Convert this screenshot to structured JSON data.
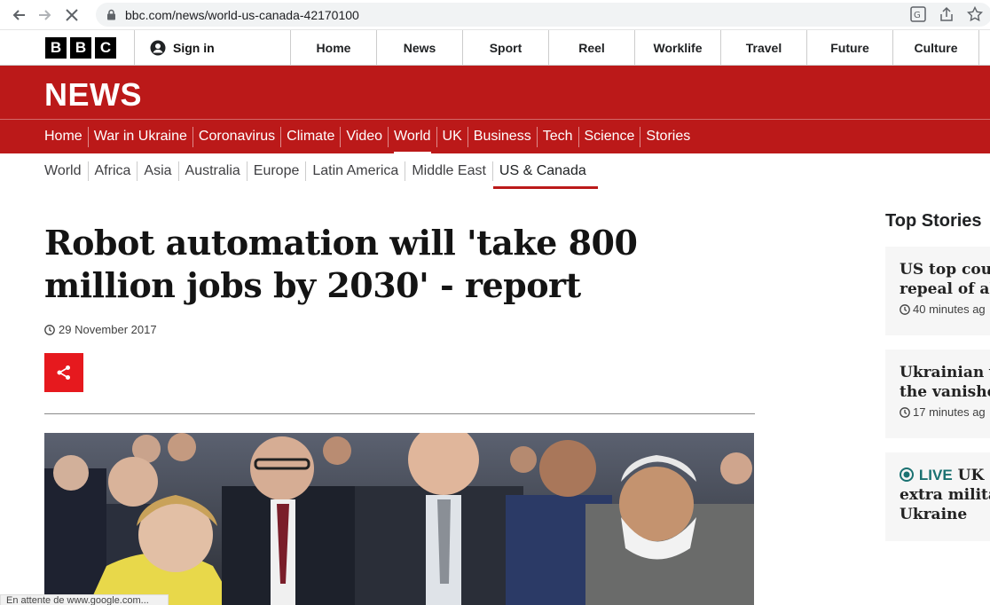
{
  "browser": {
    "url": "bbc.com/news/world-us-canada-42170100",
    "status_text": "En attente de www.google.com..."
  },
  "masthead": {
    "logo_letters": [
      "B",
      "B",
      "C"
    ],
    "sign_in": "Sign in",
    "nav": [
      "Home",
      "News",
      "Sport",
      "Reel",
      "Worklife",
      "Travel",
      "Future",
      "Culture"
    ]
  },
  "news": {
    "logo": "NEWS",
    "nav": [
      "Home",
      "War in Ukraine",
      "Coronavirus",
      "Climate",
      "Video",
      "World",
      "UK",
      "Business",
      "Tech",
      "Science",
      "Stories"
    ],
    "active_nav": "World",
    "subnav": [
      "World",
      "Africa",
      "Asia",
      "Australia",
      "Europe",
      "Latin America",
      "Middle East",
      "US & Canada"
    ],
    "active_subnav": "US & Canada"
  },
  "article": {
    "headline_line1": "Robot automation will 'take 800",
    "headline_line2": "million jobs by 2030' - report",
    "date": "29 November 2017"
  },
  "sidebar": {
    "title": "Top Stories",
    "stories": [
      {
        "line1": "US top cour",
        "line2": "repeal of ab",
        "time": "40 minutes ag"
      },
      {
        "line1": "Ukrainian v",
        "line2": "the vanishe",
        "time": "17 minutes ag"
      },
      {
        "live": "LIVE",
        "line1": "UK",
        "line2": "extra milita",
        "line3": "Ukraine"
      }
    ]
  },
  "colors": {
    "bbc_red": "#bb1919",
    "share_red": "#e6191e",
    "live_teal": "#1a7171"
  }
}
